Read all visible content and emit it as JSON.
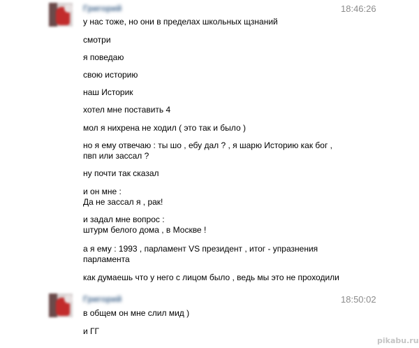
{
  "conversation": {
    "groups": [
      {
        "author": "Григорий",
        "time": "18:46:26",
        "messages": [
          "у нас тоже, но они в пределах школьных щзнаний",
          "смотри",
          "я поведаю",
          "свою историю",
          "наш Историк",
          "хотел мне поставить 4",
          "мол я нихрена не ходил ( это так и было )",
          "но я ему отвечаю : ты шо , ебу дал ? , я шарю Историю как бог ,\nпвп или зассал ?",
          "ну почти так сказал",
          "и он мне :\nДа не зассал я , рак!",
          "и задал мне вопрос :\nштурм белого дома , в Москве !",
          "а я ему : 1993 , парламент VS президент , итог - упразнения\nпарламента",
          "как думаешь что у него с лицом было , ведь мы это не проходили"
        ]
      },
      {
        "author": "Григорий",
        "time": "18:50:02",
        "messages": [
          "в общем он мне слил мид )",
          "и ГГ"
        ]
      }
    ]
  },
  "watermark": "pikabu.ru"
}
